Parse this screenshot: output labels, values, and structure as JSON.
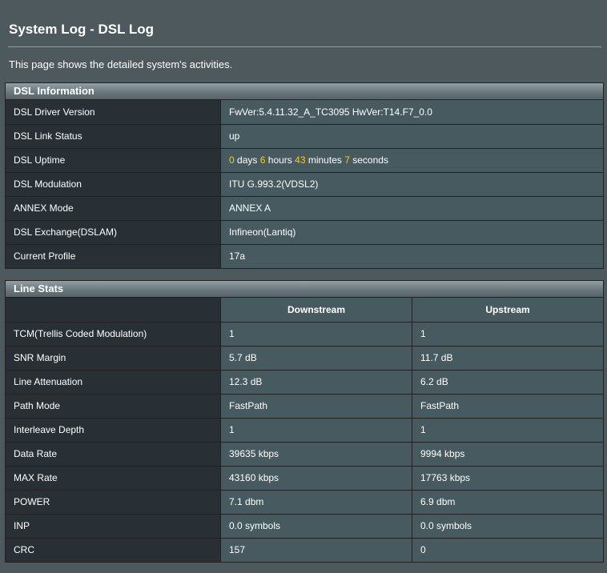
{
  "page": {
    "title": "System Log - DSL Log",
    "description": "This page shows the detailed system's activities."
  },
  "dsl_information": {
    "header": "DSL Information",
    "rows": [
      {
        "label": "DSL Driver Version",
        "value": "FwVer:5.4.11.32_A_TC3095 HwVer:T14.F7_0.0"
      },
      {
        "label": "DSL Link Status",
        "value": "up"
      },
      {
        "label": "DSL Uptime",
        "value": ""
      },
      {
        "label": "DSL Modulation",
        "value": "ITU G.993.2(VDSL2)"
      },
      {
        "label": "ANNEX Mode",
        "value": "ANNEX A"
      },
      {
        "label": "DSL Exchange(DSLAM)",
        "value": "Infineon(Lantiq)"
      },
      {
        "label": "Current Profile",
        "value": "17a"
      }
    ],
    "uptime": {
      "days": "0",
      "days_unit": "days",
      "hours": "6",
      "hours_unit": "hours",
      "minutes": "43",
      "minutes_unit": "minutes",
      "seconds": "7",
      "seconds_unit": "seconds"
    }
  },
  "line_stats": {
    "header": "Line Stats",
    "columns": [
      "Downstream",
      "Upstream"
    ],
    "rows": [
      {
        "label": "TCM(Trellis Coded Modulation)",
        "down": "1",
        "up": "1"
      },
      {
        "label": "SNR Margin",
        "down": "5.7 dB",
        "up": "11.7 dB"
      },
      {
        "label": "Line Attenuation",
        "down": "12.3 dB",
        "up": "6.2 dB"
      },
      {
        "label": "Path Mode",
        "down": "FastPath",
        "up": "FastPath"
      },
      {
        "label": "Interleave Depth",
        "down": "1",
        "up": "1"
      },
      {
        "label": "Data Rate",
        "down": "39635 kbps",
        "up": "9994 kbps"
      },
      {
        "label": "MAX Rate",
        "down": "43160 kbps",
        "up": "17763 kbps"
      },
      {
        "label": "POWER",
        "down": "7.1 dbm",
        "up": "6.9 dbm"
      },
      {
        "label": "INP",
        "down": "0.0 symbols",
        "up": "0.0 symbols"
      },
      {
        "label": "CRC",
        "down": "157",
        "up": "0"
      }
    ]
  },
  "colors": {
    "background": "#4d595d",
    "label_cell": "#283036",
    "value_cell": "#475a5f",
    "highlight": "#ffcc00"
  }
}
